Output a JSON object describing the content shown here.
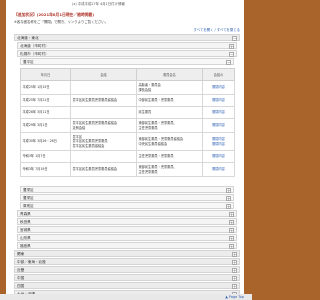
{
  "header": {
    "top_note": "(x) 平成平成27年 4月1日付け情報",
    "heading": "【追加状況】(2021年8月1日現在／随時掲載)",
    "sub_note": "※各な固名称をご「開閉」で開き、リンクよりご覧ください。",
    "expand_link": "すべてを開く / すべてを閉じる"
  },
  "sections": [
    {
      "label": "北海道・東北",
      "sign": "−"
    },
    {
      "label": "北海道（市町村）",
      "sign": "+"
    },
    {
      "label": "札幌市（市町村）",
      "sign": "−"
    },
    {
      "label": "豊平区",
      "sign": "−"
    }
  ],
  "table": {
    "headers": [
      "年月日",
      "会議",
      "委員会名",
      "会議の"
    ],
    "rows": [
      {
        "date": "平成25年 1月15日",
        "meeting": "",
        "committee": "高齢者・委員会\n課長会議",
        "link": "開閉内容"
      },
      {
        "date": "平成25年 7月21日",
        "meeting": "豊平区民生委員児童委員協議会",
        "committee": "中部民生委員・児童委員",
        "link": "開閉内容"
      },
      {
        "date": "平成28年 3月11日",
        "meeting": "",
        "committee": "民生委員",
        "link": "開閉内容"
      },
      {
        "date": "平成29年 3月1日",
        "meeting": "豊平区民生委員児童委員協議会\n定例会議",
        "committee": "東部民生委員・児童委員、\n主任児童委員",
        "link": "開閉内容"
      },
      {
        "date": "平成30年 3月26・26日",
        "meeting": "豊平区\n豊平区民生委員児童委員\n豊平区民生委員協議会",
        "committee": "東部民生委員・児童委員協議会\n中央民生委員協議会",
        "link": "開閉内容\n開閉内容"
      },
      {
        "date": "令和3年 1月7日",
        "meeting": "",
        "committee": "主任児童委員・児童委員",
        "link": "開閉内容"
      },
      {
        "date": "令和3年 7月19日",
        "meeting": "豊平区民生委員児童委員協議会",
        "committee": "東部民生委員・児童委員、\n主任児童委員",
        "link": "開閉内容"
      }
    ]
  },
  "after_sections": [
    {
      "label": "豊栄区",
      "sign": "+",
      "level": "sub2"
    },
    {
      "label": "豊栄区",
      "sign": "+",
      "level": "sub2"
    },
    {
      "label": "厚別区",
      "sign": "+",
      "level": "sub2"
    },
    {
      "label": "青森県",
      "sign": "+",
      "level": "sub"
    },
    {
      "label": "秋田県",
      "sign": "+",
      "level": "sub"
    },
    {
      "label": "宮城県",
      "sign": "+",
      "level": "sub"
    },
    {
      "label": "山形県",
      "sign": "+",
      "level": "sub"
    },
    {
      "label": "福島県",
      "sign": "+",
      "level": "sub"
    },
    {
      "label": "関東",
      "sign": "+",
      "level": "top"
    },
    {
      "label": "中部／東海・北陸",
      "sign": "+",
      "level": "top"
    },
    {
      "label": "近畿",
      "sign": "+",
      "level": "top"
    },
    {
      "label": "中国",
      "sign": "+",
      "level": "top"
    },
    {
      "label": "四国",
      "sign": "+",
      "level": "top"
    },
    {
      "label": "九州・沖縄",
      "sign": "+",
      "level": "top"
    }
  ],
  "back_to_top": "▲ Page Top"
}
